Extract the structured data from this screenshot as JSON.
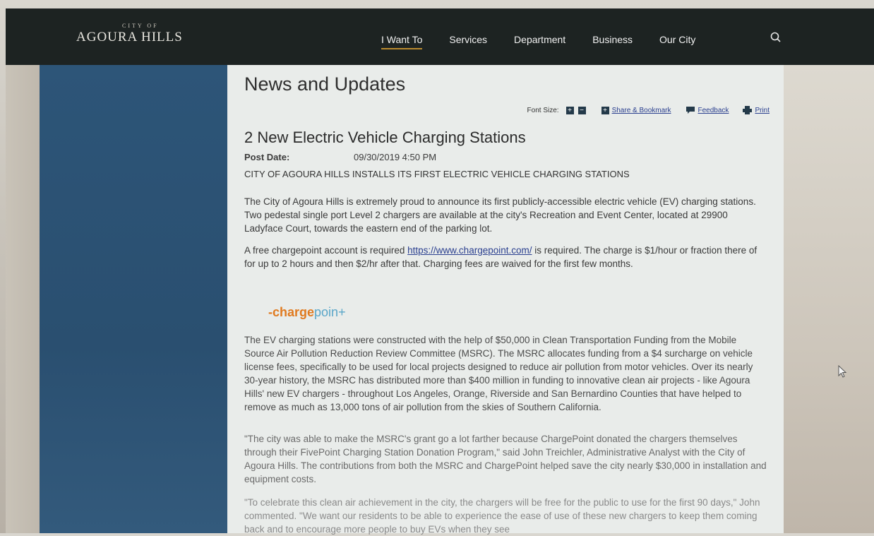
{
  "header": {
    "logo_small": "CITY OF",
    "logo_main": "Agoura Hills",
    "nav": [
      "I Want To",
      "Services",
      "Department",
      "Business",
      "Our City"
    ]
  },
  "page": {
    "title": "News and Updates",
    "toolbar": {
      "font_size_label": "Font Size:",
      "share": "Share & Bookmark",
      "feedback": "Feedback",
      "print": "Print"
    }
  },
  "article": {
    "title": "2 New Electric Vehicle Charging Stations",
    "post_date_label": "Post Date:",
    "post_date": "09/30/2019 4:50 PM",
    "headline": "CITY OF AGOURA HILLS INSTALLS ITS FIRST ELECTRIC VEHICLE CHARGING STATIONS",
    "p1": "The City of Agoura Hills is extremely proud to announce its first publicly-accessible electric vehicle (EV) charging stations. Two pedestal single port Level 2 chargers are available at the city's Recreation and Event Center, located at 29900 Ladyface Court, towards the eastern end of the parking lot.",
    "p2_before": "A free chargepoint account is required ",
    "p2_link": "https://www.chargepoint.com/",
    "p2_after": " is required. The charge is $1/hour or fraction there of for up to 2 hours and then $2/hr after that.  Charging fees are waived for the first few months.",
    "logo_text_1": "-charge",
    "logo_text_2": "poin+",
    "p3": "The EV charging stations were constructed with the help of $50,000 in Clean Transportation Funding from the Mobile Source Air Pollution Reduction Review Committee (MSRC). The MSRC allocates funding from a $4 surcharge on vehicle license fees, specifically to be used for local projects designed to reduce air pollution from motor vehicles. Over its nearly 30-year history, the MSRC has distributed more than $400 million in funding to innovative clean air projects - like Agoura Hills' new EV chargers - throughout Los Angeles, Orange, Riverside and San Bernardino Counties that have helped to remove as much as 13,000 tons of air pollution from the skies of Southern California.",
    "p4": "\"The city was able to make the MSRC's grant go a lot farther because ChargePoint donated the chargers themselves through their FivePoint Charging Station Donation Program,\" said John Treichler, Administrative Analyst with the City of Agoura Hills. The contributions from both the MSRC and ChargePoint helped save the city nearly $30,000 in installation and equipment costs.",
    "p5": "\"To celebrate this clean air achievement in the city, the chargers will be free for the public to use for the first 90 days,\" John commented. \"We want our residents to be able to experience the ease of use of these new chargers to keep them coming back and to encourage more people to buy EVs when they see"
  },
  "colors": {
    "header_bg": "#1d2322",
    "nav_underline": "#b98a2e",
    "sidebar_blue": "#2d5578",
    "link": "#2a3f8f",
    "logo_orange": "#e07a1f",
    "logo_blue": "#5aa6c8"
  }
}
